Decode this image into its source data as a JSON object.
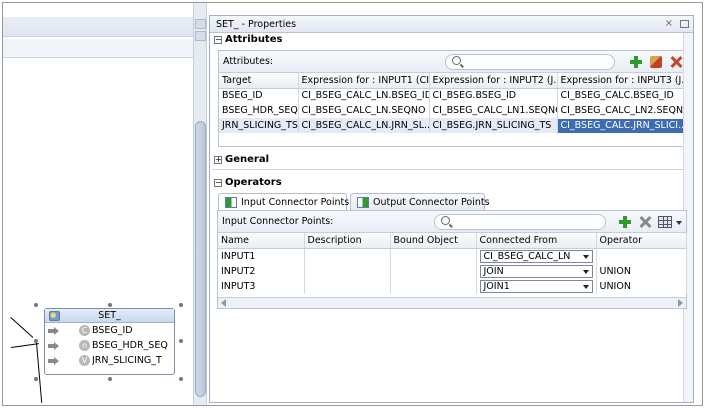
{
  "node": {
    "title": "SET_",
    "rows": [
      {
        "badge": "C",
        "label": "BSEG_ID"
      },
      {
        "badge": "n",
        "label": "BSEG_HDR_SEQ"
      },
      {
        "badge": "V",
        "label": "JRN_SLICING_T"
      }
    ]
  },
  "panel": {
    "title": "SET_ - Properties",
    "close": "×"
  },
  "attributes": {
    "section": "Attributes",
    "label": "Attributes:",
    "columns": [
      "Target",
      "Expression for : INPUT1 (CI...",
      "Expression for : INPUT2 (J...",
      "Expression for : INPUT3 (J..."
    ],
    "rows": [
      [
        "BSEG_ID",
        "CI_BSEG_CALC_LN.BSEG_ID",
        "CI_BSEG.BSEG_ID",
        "CI_BSEG_CALC.BSEG_ID"
      ],
      [
        "BSEG_HDR_SEQ",
        "CI_BSEG_CALC_LN.SEQNO",
        "CI_BSEG_CALC_LN1.SEQNO",
        "CI_BSEG_CALC_LN2.SEQNO"
      ],
      [
        "JRN_SLICING_TS",
        "CI_BSEG_CALC_LN.JRN_SL...",
        "CI_BSEG.JRN_SLICING_TS",
        "CI_BSEG_CALC.JRN_SLICI..."
      ]
    ]
  },
  "general": {
    "section": "General"
  },
  "operators": {
    "section": "Operators",
    "tabs": [
      "Input Connector Points",
      "Output Connector Points"
    ],
    "label": "Input Connector Points:",
    "columns": [
      "Name",
      "Description",
      "Bound Object",
      "Connected From",
      "Operator"
    ],
    "rows": [
      {
        "name": "INPUT1",
        "description": "",
        "bound": "",
        "from": "CI_BSEG_CALC_LN",
        "operator": ""
      },
      {
        "name": "INPUT2",
        "description": "",
        "bound": "",
        "from": "JOIN",
        "operator": "UNION"
      },
      {
        "name": "INPUT3",
        "description": "",
        "bound": "",
        "from": "JOIN1",
        "operator": "UNION"
      }
    ]
  },
  "colors": {
    "selection": "#3e6cb2",
    "add": "#2f9b2f",
    "delete": "#c24a2a"
  }
}
